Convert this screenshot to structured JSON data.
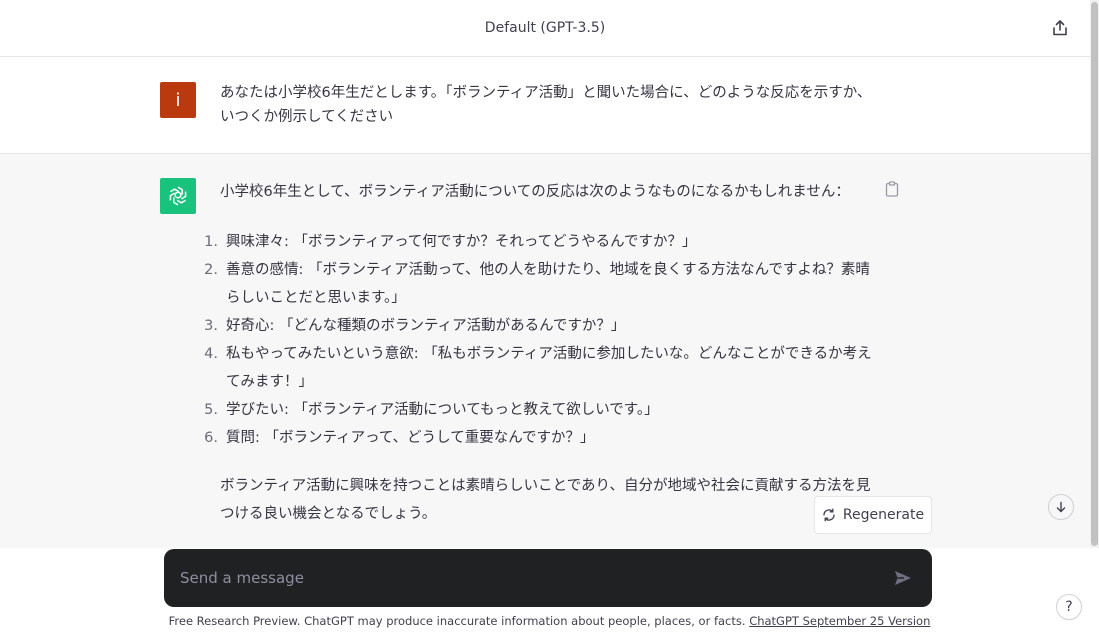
{
  "header": {
    "title": "Default (GPT-3.5)"
  },
  "user_message": {
    "avatar_letter": "i",
    "text": "あなたは小学校6年生だとします。「ボランティア活動」と聞いた場合に、どのような反応を示すか、いつくか例示してください"
  },
  "assistant_message": {
    "intro": "小学校6年生として、ボランティア活動についての反応は次のようなものになるかもしれません：",
    "items": [
      {
        "num": "1.",
        "text": "興味津々: 「ボランティアって何ですか？それってどうやるんですか？」"
      },
      {
        "num": "2.",
        "text": "善意の感情: 「ボランティア活動って、他の人を助けたり、地域を良くする方法なんですよね？素晴らしいことだと思います。」"
      },
      {
        "num": "3.",
        "text": "好奇心: 「どんな種類のボランティア活動があるんですか？」"
      },
      {
        "num": "4.",
        "text": "私もやってみたいという意欲: 「私もボランティア活動に参加したいな。どんなことができるか考えてみます！」"
      },
      {
        "num": "5.",
        "text": "学びたい: 「ボランティア活動についてもっと教えて欲しいです。」"
      },
      {
        "num": "6.",
        "text": "質問: 「ボランティアって、どうして重要なんですか？」"
      }
    ],
    "outro": "ボランティア活動に興味を持つことは素晴らしいことであり、自分が地域や社会に貢献する方法を見つける良い機会となるでしょう。"
  },
  "regenerate_label": "Regenerate",
  "composer": {
    "placeholder": "Send a message",
    "value": ""
  },
  "footer": {
    "text": "Free Research Preview. ChatGPT may produce inaccurate information about people, places, or facts. ",
    "link": "ChatGPT September 25 Version"
  },
  "help_label": "?",
  "colors": {
    "user_avatar": "#b83a0e",
    "gpt_avatar": "#19c37d",
    "composer_bg": "#202123",
    "assistant_bg": "#f7f7f8"
  }
}
